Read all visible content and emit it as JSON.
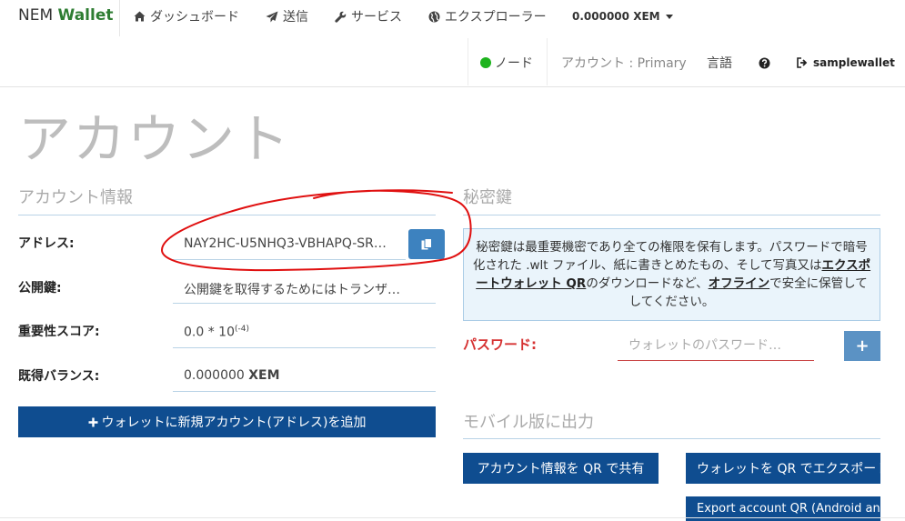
{
  "navbar": {
    "brand_part1": "NEM",
    "brand_part2": "Wallet",
    "dashboard": "ダッシュボード",
    "send": "送信",
    "services": "サービス",
    "explorer": "エクスプローラー",
    "balance_value": "0.000000",
    "balance_unit": "XEM",
    "node_label": "ノード",
    "account_label": "アカウント : Primary",
    "language": "言語",
    "wallet_name": "samplewallet"
  },
  "page": {
    "title": "アカウント"
  },
  "account_info": {
    "section_title": "アカウント情報",
    "address_label": "アドレス:",
    "address_value": "NAY2HC-U5NHQ3-VBHAPQ-SR…",
    "pubkey_label": "公開鍵:",
    "pubkey_value": "公開鍵を取得するためにはトランザ…",
    "importance_label": "重要性スコア:",
    "importance_base": "0.0 * 10",
    "importance_exp": "(-4)",
    "balance_label": "既得バランス:",
    "balance_value": "0.000000",
    "balance_unit": "XEM",
    "add_account_button": "ウォレットに新規アカウント(アドレス)を追加"
  },
  "private_key": {
    "section_title": "秘密鍵",
    "info_part1": "秘密鍵は最重要機密であり全ての権限を保有します。パスワードで暗号化された .wlt ファイル、紙に書きとめたもの、そして写真又は",
    "info_link1": "エクスポートウォレット QR",
    "info_part2": "のダウンロードなど、",
    "info_link2": "オフライン",
    "info_part3": "で安全に保管してしてください。",
    "password_label": "パスワード:",
    "password_placeholder": "ウォレットのパスワード…",
    "plus_button": "+"
  },
  "mobile": {
    "section_title": "モバイル版に出力",
    "share_qr_button": "アカウント情報を QR で共有",
    "export_wallet_qr_button": "ウォレットを QR でエクスポート",
    "export_account_qr_button": "Export account QR (Android and iOS)"
  },
  "colors": {
    "brand_green": "#2e7d32",
    "primary_button": "#0f4d90",
    "copy_button": "#3d82bf",
    "password_red": "#d63333",
    "node_status": "#1db31d",
    "annotation_red": "#e01010"
  }
}
